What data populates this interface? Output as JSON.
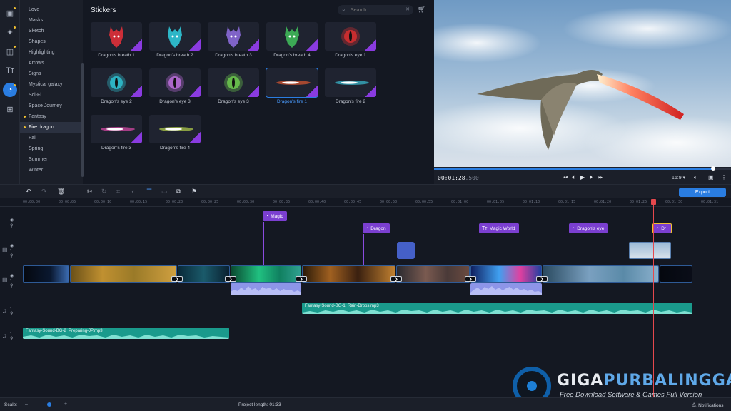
{
  "categories": [
    {
      "label": "Love",
      "dot": false
    },
    {
      "label": "Masks",
      "dot": false
    },
    {
      "label": "Sketch",
      "dot": false
    },
    {
      "label": "Shapes",
      "dot": false
    },
    {
      "label": "Highlighting",
      "dot": false
    },
    {
      "label": "Arrows",
      "dot": false
    },
    {
      "label": "Signs",
      "dot": false
    },
    {
      "label": "Mystical galaxy",
      "dot": false
    },
    {
      "label": "Sci-Fi",
      "dot": false
    },
    {
      "label": "Space Journey",
      "dot": false
    },
    {
      "label": "Fantasy",
      "dot": true
    },
    {
      "label": "Fire dragon",
      "dot": true,
      "selected": true
    },
    {
      "label": "Fall",
      "dot": false
    },
    {
      "label": "Spring",
      "dot": false
    },
    {
      "label": "Summer",
      "dot": false
    },
    {
      "label": "Winter",
      "dot": false
    }
  ],
  "stickers": {
    "title": "Stickers",
    "search_placeholder": "Search",
    "items": [
      {
        "label": "Dragon's breath 1",
        "color": "#e0303a",
        "kind": "head"
      },
      {
        "label": "Dragon's breath 2",
        "color": "#2fc6d8",
        "kind": "head"
      },
      {
        "label": "Dragon's breath 3",
        "color": "#8a6ad8",
        "kind": "head"
      },
      {
        "label": "Dragon's breath 4",
        "color": "#3fb85a",
        "kind": "head"
      },
      {
        "label": "Dragon's eye 1",
        "color": "#e03030",
        "kind": "eye"
      },
      {
        "label": "Dragon's eye 2",
        "color": "#30c8d8",
        "kind": "eye"
      },
      {
        "label": "Dragon's eye 3",
        "color": "#c070e0",
        "kind": "eye"
      },
      {
        "label": "Dragon's eye 3",
        "color": "#70d050",
        "kind": "eye"
      },
      {
        "label": "Dragon's fire 1",
        "color": "#ff6030",
        "kind": "fire",
        "selected": true
      },
      {
        "label": "Dragon's fire 2",
        "color": "#40d8f0",
        "kind": "fire"
      },
      {
        "label": "Dragon's fire 3",
        "color": "#ff50c0",
        "kind": "fire"
      },
      {
        "label": "Dragon's fire 4",
        "color": "#d0f050",
        "kind": "fire"
      }
    ]
  },
  "preview": {
    "timecode": "00:01:28",
    "timecode_ms": ".500",
    "aspect_ratio": "16:9",
    "progress": 0.94
  },
  "toolbar": {
    "export_label": "Export"
  },
  "ruler": [
    "00:00:00",
    "00:00:05",
    "00:00:10",
    "00:00:15",
    "00:00:20",
    "00:00:25",
    "00:00:30",
    "00:00:35",
    "00:00:40",
    "00:00:45",
    "00:00:50",
    "00:00:55",
    "00:01:00",
    "00:01:05",
    "00:01:10",
    "00:01:15",
    "00:01:20",
    "00:01:25",
    "00:01:30",
    "00:01:31"
  ],
  "titles": [
    {
      "label": "Magic",
      "icon": "sticker"
    },
    {
      "label": "Dragon",
      "icon": "sticker"
    },
    {
      "label": "Magic World",
      "icon": "text"
    },
    {
      "label": "Dragon's eye",
      "icon": "sticker"
    },
    {
      "label": "Dr",
      "icon": "sticker"
    }
  ],
  "audio": [
    {
      "label": "Fantasy-Sound-BG-1_Rain-Drops.mp3",
      "color": "#1a9a8c"
    },
    {
      "label": "Fantasy-Sound-BG-2_Preparing-JP.mp3",
      "color": "#1a9a8c"
    }
  ],
  "status": {
    "scale_label": "Scale:",
    "project_length": "Project length:  01:33",
    "notifications": "Notifications"
  },
  "watermark": {
    "title_a": "GIGA",
    "title_b": "PURBALINGGA",
    "subtitle": "Free Download Software & Games Full Version"
  },
  "colors": {
    "accent": "#2a7de1",
    "title_clip": "#7b3fd0",
    "audio_clip": "#1a9a8c",
    "playhead": "#e5484d"
  }
}
